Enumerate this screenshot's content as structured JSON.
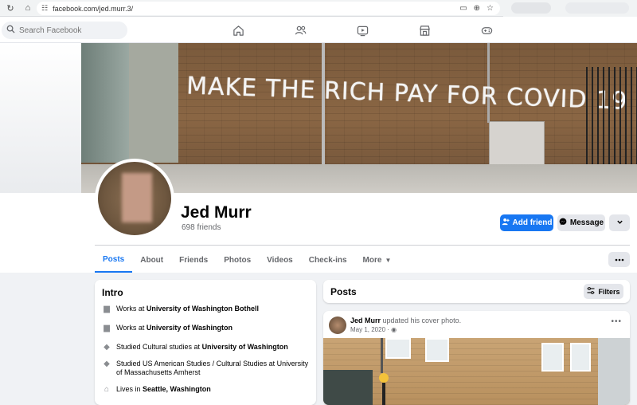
{
  "browser": {
    "url": "facebook.com/jed.murr.3/"
  },
  "header": {
    "search_placeholder": "Search Facebook"
  },
  "cover": {
    "graffiti_text": "MAKE THE RICH PAY FOR COVID 19"
  },
  "profile": {
    "name": "Jed Murr",
    "friends": "698 friends",
    "add_friend_label": "Add friend",
    "message_label": "Message"
  },
  "tabs": [
    {
      "label": "Posts"
    },
    {
      "label": "About"
    },
    {
      "label": "Friends"
    },
    {
      "label": "Photos"
    },
    {
      "label": "Videos"
    },
    {
      "label": "Check-ins"
    },
    {
      "label": "More"
    }
  ],
  "intro": {
    "title": "Intro",
    "items": [
      {
        "prefix": "Works at ",
        "bold": "University of Washington Bothell",
        "icon": "briefcase-icon"
      },
      {
        "prefix": "Works at ",
        "bold": "University of Washington",
        "icon": "briefcase-icon"
      },
      {
        "prefix": "Studied Cultural studies at ",
        "bold": "University of Washington",
        "icon": "graduation-cap-icon"
      },
      {
        "prefix": "Studied US American Studies / Cultural Studies at University of Massachusetts Amherst",
        "bold": "",
        "icon": "graduation-cap-icon"
      },
      {
        "prefix": "Lives in ",
        "bold": "Seattle, Washington",
        "icon": "home-icon"
      }
    ]
  },
  "posts": {
    "title": "Posts",
    "filters_label": "Filters",
    "first_post": {
      "author": "Jed Murr",
      "action": " updated his cover photo.",
      "date": "May 1, 2020 · "
    }
  }
}
